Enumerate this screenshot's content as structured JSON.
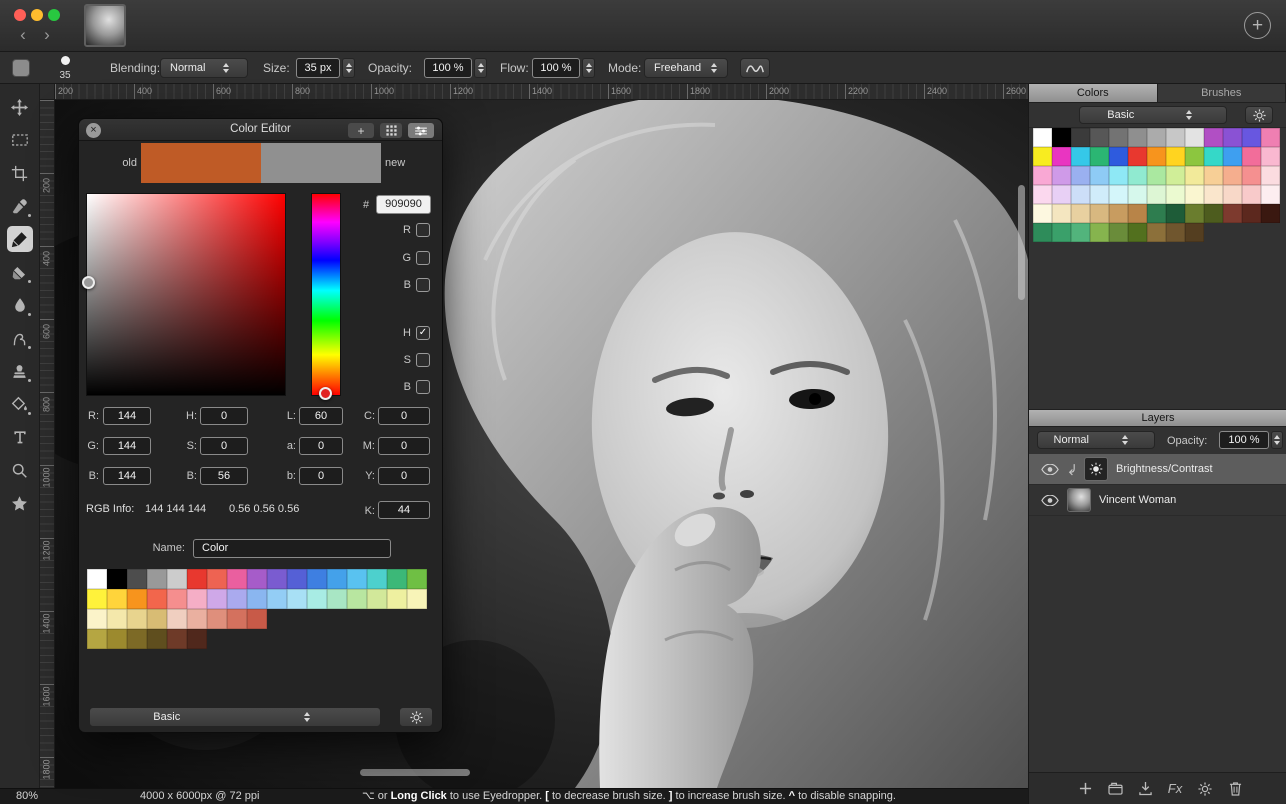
{
  "icons": {
    "close": "×",
    "back": "‹",
    "forward": "›",
    "plus": "+"
  },
  "window": {
    "traffic_lights": [
      {
        "name": "close",
        "color": "#ff5f57"
      },
      {
        "name": "minimize",
        "color": "#febc2e"
      },
      {
        "name": "zoom",
        "color": "#28c840"
      }
    ],
    "new_document_label": "+"
  },
  "toolbar": {
    "brush_preview_size": "35",
    "blending_label": "Blending:",
    "blending_value": "Normal",
    "size_label": "Size:",
    "size_value": "35 px",
    "opacity_label": "Opacity:",
    "opacity_value": "100 %",
    "flow_label": "Flow:",
    "flow_value": "100 %",
    "mode_label": "Mode:",
    "mode_value": "Freehand"
  },
  "rulers": {
    "horizontal": [
      "200",
      "400",
      "600",
      "800",
      "1000",
      "1200",
      "1400",
      "1600",
      "1800",
      "2000",
      "2200",
      "2400",
      "2600"
    ],
    "vertical": [
      "200",
      "400",
      "600",
      "800",
      "1000",
      "1200",
      "1400",
      "1600",
      "1800"
    ]
  },
  "tools": [
    {
      "name": "move-tool",
      "icon": "move",
      "selected": false,
      "submenu": false
    },
    {
      "name": "rectangular-selection-tool",
      "icon": "marquee",
      "selected": false,
      "submenu": false
    },
    {
      "name": "crop-tool",
      "icon": "crop",
      "selected": false,
      "submenu": false
    },
    {
      "name": "eyedropper-tool",
      "icon": "eyedropper",
      "selected": false,
      "submenu": true
    },
    {
      "name": "paint-brush-tool",
      "icon": "brush",
      "selected": true,
      "submenu": false
    },
    {
      "name": "eraser-tool",
      "icon": "eraser",
      "selected": false,
      "submenu": true
    },
    {
      "name": "blur-tool",
      "icon": "blur",
      "selected": false,
      "submenu": true
    },
    {
      "name": "smudge-tool",
      "icon": "smudge",
      "selected": false,
      "submenu": true
    },
    {
      "name": "clone-stamp-tool",
      "icon": "clone",
      "selected": false,
      "submenu": true
    },
    {
      "name": "paint-bucket-tool",
      "icon": "bucket",
      "selected": false,
      "submenu": true
    },
    {
      "name": "text-tool",
      "icon": "text",
      "selected": false,
      "submenu": false
    },
    {
      "name": "zoom-tool",
      "icon": "zoom",
      "selected": false,
      "submenu": false
    },
    {
      "name": "shapes-tool",
      "icon": "star",
      "selected": false,
      "submenu": false
    }
  ],
  "color_editor": {
    "title": "Color Editor",
    "add_button_label": "+",
    "old_label": "old",
    "new_label": "new",
    "old_color": "#bf5b26",
    "new_color": "#909090",
    "hex_label": "#",
    "hex_value": "909090",
    "channel_checkboxes": [
      {
        "label": "R",
        "checked": false
      },
      {
        "label": "G",
        "checked": false
      },
      {
        "label": "B",
        "checked": false
      },
      {
        "label": "H",
        "checked": true
      },
      {
        "label": "S",
        "checked": false
      },
      {
        "label": "B",
        "checked": false
      }
    ],
    "fields": [
      [
        {
          "label": "R:",
          "value": "144"
        },
        {
          "label": "H:",
          "value": "0"
        },
        {
          "label": "L:",
          "value": "60"
        },
        {
          "label": "C:",
          "value": "0"
        }
      ],
      [
        {
          "label": "G:",
          "value": "144"
        },
        {
          "label": "S:",
          "value": "0"
        },
        {
          "label": "a:",
          "value": "0"
        },
        {
          "label": "M:",
          "value": "0"
        }
      ],
      [
        {
          "label": "B:",
          "value": "144"
        },
        {
          "label": "B:",
          "value": "56"
        },
        {
          "label": "b:",
          "value": "0"
        },
        {
          "label": "Y:",
          "value": "0"
        }
      ]
    ],
    "rgb_info_label": "RGB Info:",
    "rgb_info_values": "144 144 144",
    "rgb_info_floats": "0.56 0.56 0.56",
    "k_label": "K:",
    "k_value": "44",
    "name_label": "Name:",
    "name_value": "Color",
    "preset_value": "Basic",
    "swatches": [
      [
        "#ffffff",
        "#000000",
        "#4d4d4d",
        "#999999",
        "#cccccc",
        "#e8382f",
        "#ee6352",
        "#ea5f9f",
        "#a65cc9",
        "#7a5cd0",
        "#5560d6",
        "#3e7fe1",
        "#44a1ea",
        "#59c2f0",
        "#4dd0cd",
        "#3cb878",
        "#6fbf44"
      ],
      [
        "#fff23b",
        "#ffd43b",
        "#f7941d",
        "#f2664c",
        "#f58e8e",
        "#f5aec6",
        "#cfa8e8",
        "#aaaaee",
        "#8ab6f0",
        "#93cdf5",
        "#a8e0f5",
        "#a8ece4",
        "#a8e6c4",
        "#b8e6a0",
        "#d2e89a",
        "#eef0a0",
        "#f8f4b8"
      ],
      [
        "#fbf3c9",
        "#f4e8ab",
        "#e8d48e",
        "#d8bc74",
        "#f0cfc0",
        "#eab0a0",
        "#df8f7c",
        "#d4715e",
        "#c85a48"
      ],
      [
        "#b5a642",
        "#9c8a2e",
        "#7d6a26",
        "#5f4e1e",
        "#6e3a28",
        "#50281c"
      ]
    ]
  },
  "colors_panel": {
    "tabs": [
      {
        "label": "Colors",
        "active": true
      },
      {
        "label": "Brushes",
        "active": false
      }
    ],
    "preset_value": "Basic",
    "swatches": [
      [
        "#ffffff",
        "#000000",
        "#3b3b3b",
        "#575757",
        "#737373",
        "#8f8f8f",
        "#ababab",
        "#c7c7c7",
        "#e3e3e3",
        "#b14fc4",
        "#8a52d4",
        "#6857e0",
        "#ef7fb2"
      ],
      [
        "#f8ec20",
        "#e935c1",
        "#35c8e8",
        "#2bb673",
        "#2e5bde",
        "#e8382f",
        "#f7941d",
        "#ffd420",
        "#8cc63f",
        "#35d8c8",
        "#3e9ff0",
        "#f26d9a",
        "#f9b8d0"
      ],
      [
        "#f9a8d4",
        "#cf9ae8",
        "#9ab0f0",
        "#8ecbf5",
        "#8ee8f5",
        "#90ead0",
        "#aae8a0",
        "#d0ee98",
        "#f2ea9a",
        "#f7cf96",
        "#f5ae8e",
        "#f59090",
        "#fbdce0"
      ],
      [
        "#fbd8ee",
        "#e8d0f5",
        "#ccdef8",
        "#d0ecfa",
        "#d4f6fa",
        "#d6f8ec",
        "#ddf6d4",
        "#ebfad0",
        "#faf6d0",
        "#fae6cc",
        "#f8d8c8",
        "#f8caca",
        "#fdeef0"
      ],
      [
        "#fdf8e0",
        "#f4e6c0",
        "#e8d0a0",
        "#d8b880",
        "#c89c60",
        "#b88448",
        "#2e7d4f",
        "#1e5c38",
        "#6a7d2e",
        "#4d5c1e",
        "#7d3a2e",
        "#5c281e",
        "#3a1810"
      ],
      [
        "#2e8c5a",
        "#3aa06a",
        "#52b47c",
        "#86b44e",
        "#6a8c3a",
        "#52701e",
        "#8c703a",
        "#70562e",
        "#543e20"
      ]
    ]
  },
  "layers_panel": {
    "title": "Layers",
    "blend_mode": "Normal",
    "opacity_label": "Opacity:",
    "opacity_value": "100 %",
    "layers": [
      {
        "name": "Brightness/Contrast",
        "type": "adjustment",
        "selected": true,
        "visible": true,
        "clipped": true
      },
      {
        "name": "Vincent Woman",
        "type": "image",
        "selected": false,
        "visible": true,
        "clipped": false
      }
    ],
    "actions": [
      {
        "name": "add-layer-button",
        "icon": "plus"
      },
      {
        "name": "new-group-button",
        "icon": "group"
      },
      {
        "name": "import-button",
        "icon": "import"
      },
      {
        "name": "effects-button",
        "icon": "fx",
        "label": "Fx"
      },
      {
        "name": "adjustments-button",
        "icon": "gear"
      },
      {
        "name": "delete-layer-button",
        "icon": "trash"
      }
    ]
  },
  "status_bar": {
    "zoom": "80%",
    "document_info": "4000 x 6000px @ 72 ppi",
    "hint_segments": [
      {
        "text": "⌥ or ",
        "bold": false
      },
      {
        "text": "Long Click",
        "bold": true
      },
      {
        "text": " to use Eyedropper.  ",
        "bold": false
      },
      {
        "text": "[",
        "bold": true
      },
      {
        "text": " to decrease brush size.  ",
        "bold": false
      },
      {
        "text": "]",
        "bold": true
      },
      {
        "text": " to increase brush size.  ",
        "bold": false
      },
      {
        "text": "^",
        "bold": true
      },
      {
        "text": " to disable snapping.",
        "bold": false
      }
    ]
  }
}
